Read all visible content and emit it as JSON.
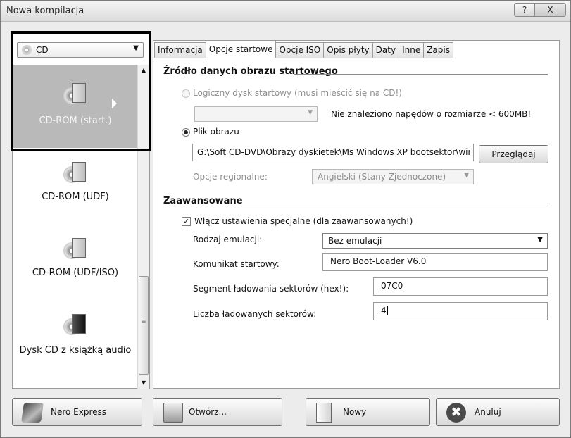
{
  "window": {
    "title": "Nowa kompilacja",
    "help_btn": "?",
    "close_btn": "X"
  },
  "left": {
    "combo_value": "CD",
    "items": [
      {
        "label": "CD-ROM (start.)",
        "icon": "cd-rom-boot-icon"
      },
      {
        "label": "CD-ROM (UDF)",
        "icon": "cd-rom-udf-icon"
      },
      {
        "label": "CD-ROM (UDF/ISO)",
        "icon": "cd-rom-udf-iso-icon"
      },
      {
        "label": "Dysk CD z książką audio",
        "icon": "audio-book-cd-icon"
      }
    ],
    "scroll_grip": "≡",
    "scroll_up": "▲",
    "scroll_down": "▼"
  },
  "tabs": [
    {
      "label": "Informacja"
    },
    {
      "label": "Opcje startowe"
    },
    {
      "label": "Opcje ISO"
    },
    {
      "label": "Opis płyty"
    },
    {
      "label": "Daty"
    },
    {
      "label": "Inne"
    },
    {
      "label": "Zapis"
    }
  ],
  "boot": {
    "section_title": "Źródło danych obrazu startowego",
    "logical_disk_label": "Logiczny dysk startowy (musi mieścić się na CD!)",
    "no_drive_msg": "Nie znaleziono napędów o rozmiarze < 600MB!",
    "image_file_label": "Plik obrazu",
    "image_path": "G:\\Soft CD-DVD\\Obrazy dyskietek\\Ms Windows XP bootsektor\\winxp",
    "browse_btn": "Przeglądaj",
    "regional_label": "Opcje regionalne:",
    "regional_value": "Angielski (Stany Zjednoczone)"
  },
  "advanced": {
    "section_title": "Zaawansowane",
    "enable_label": "Włącz ustawienia specjalne (dla zaawansowanych!)",
    "enable_checked": "✓",
    "emulation_label": "Rodzaj emulacji:",
    "emulation_value": "Bez emulacji",
    "boot_msg_label": "Komunikat startowy:",
    "boot_msg_value": "Nero Boot-Loader V6.0",
    "segment_label": "Segment ładowania sektorów (hex!):",
    "segment_value": "07C0",
    "sectors_label": "Liczba ładowanych sektorów:",
    "sectors_value": "4"
  },
  "footer": {
    "nero_express": "Nero Express",
    "open": "Otwórz...",
    "new": "Nowy",
    "cancel": "Anuluj",
    "cancel_glyph": "✖"
  }
}
